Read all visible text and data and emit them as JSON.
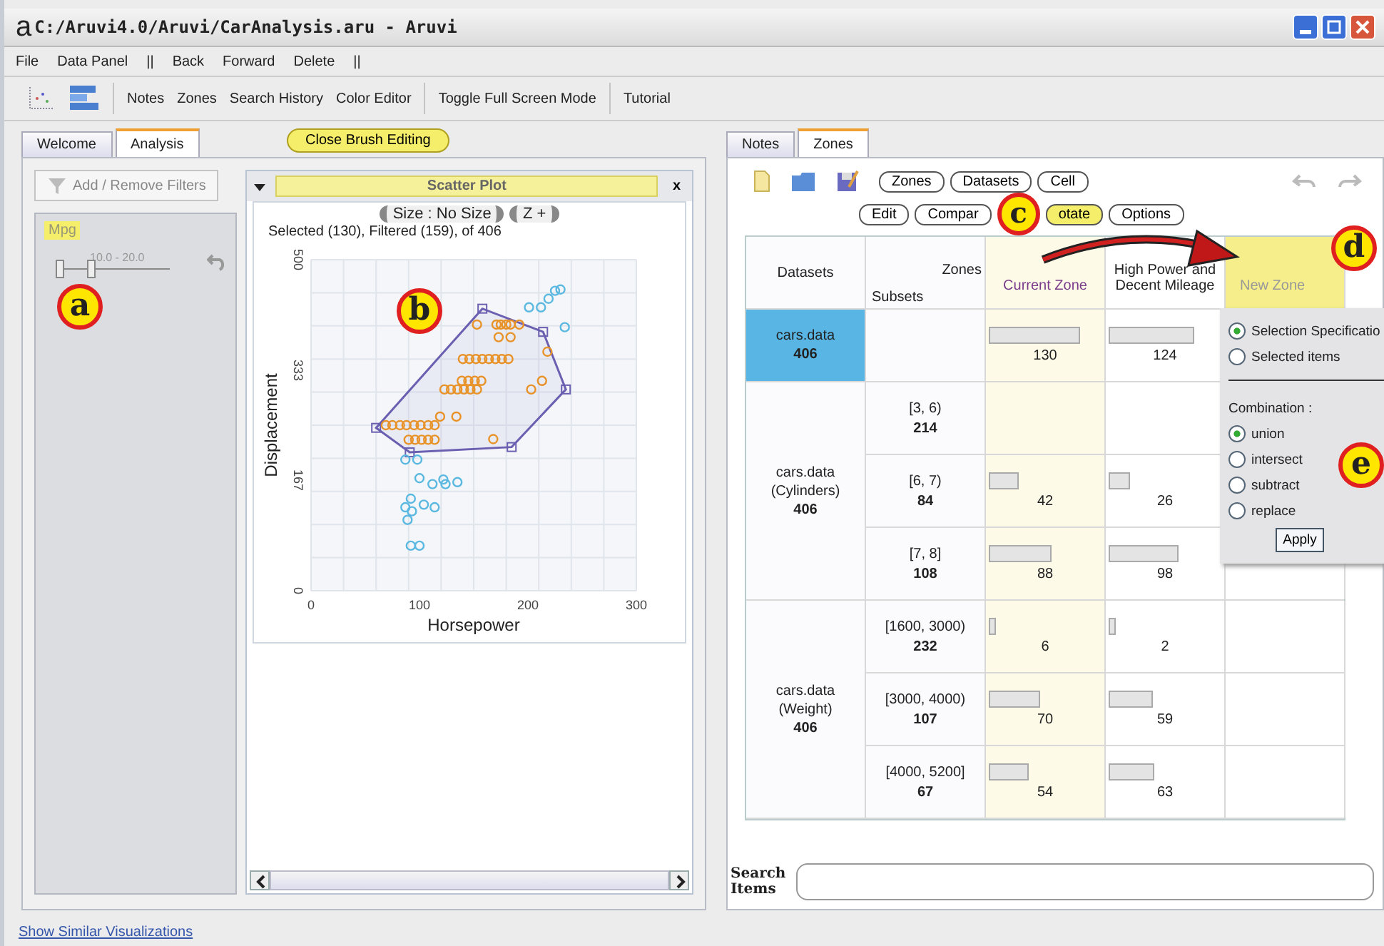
{
  "window": {
    "logo": "a",
    "title": "C:/Aruvi4.0/Aruvi/CarAnalysis.aru - Aruvi"
  },
  "menu": [
    "File",
    "Data Panel",
    "||",
    "Back",
    "Forward",
    "Delete",
    "||"
  ],
  "toolbar": [
    [
      "Notes",
      "Zones",
      "Search History",
      "Color Editor"
    ],
    [
      "Toggle Full Screen Mode"
    ],
    [
      "Tutorial"
    ]
  ],
  "left_tabs": [
    {
      "label": "Welcome",
      "selected": false
    },
    {
      "label": "Analysis",
      "selected": true
    }
  ],
  "brush_button": "Close Brush Editing",
  "filters": {
    "button": "Add / Remove Filters",
    "name": "Mpg",
    "range": "10.0 - 20.0",
    "level": 0.27
  },
  "scatter": {
    "title": "Scatter Plot",
    "close": "x",
    "size_control": "Size : No Size",
    "zoom_control": "Z +",
    "status": "Selected (130), Filtered (159),  of 406",
    "chart_data": {
      "type": "scatter",
      "xlabel": "Horsepower",
      "ylabel": "Displacement",
      "xlim": [
        0,
        300
      ],
      "ylim": [
        0,
        500
      ],
      "xticks": [
        0,
        100,
        200,
        300
      ],
      "yticks": [
        0,
        {
          "value": 167,
          "label": "167"
        },
        {
          "value": 333,
          "label": "333"
        },
        500
      ],
      "series": [
        {
          "color": "#e8932a",
          "x": [
            153,
            171,
            175,
            180,
            184,
            192,
            173,
            184,
            140,
            146,
            152,
            158,
            164,
            170,
            176,
            182,
            218,
            139,
            145,
            151,
            157,
            123,
            129,
            135,
            141,
            147,
            153,
            203,
            213,
            119,
            134,
            69,
            75,
            82,
            88,
            95,
            101,
            108,
            114,
            90,
            96,
            102,
            108,
            114,
            168
          ],
          "values": [
            402,
            402,
            402,
            402,
            402,
            402,
            383,
            383,
            350,
            350,
            350,
            350,
            350,
            350,
            350,
            350,
            361,
            317,
            317,
            317,
            317,
            304,
            304,
            304,
            304,
            304,
            304,
            304,
            317,
            263,
            263,
            250,
            250,
            250,
            250,
            250,
            250,
            250,
            250,
            228,
            228,
            228,
            228,
            228,
            229
          ]
        },
        {
          "color": "#5bb8e0",
          "x": [
            201,
            212,
            219,
            225,
            230,
            234,
            87,
            98,
            100,
            112,
            122,
            124,
            135,
            92,
            87,
            93,
            104,
            114,
            89,
            92,
            100
          ],
          "values": [
            428,
            428,
            441,
            453,
            455,
            398,
            198,
            198,
            170,
            161,
            168,
            161,
            164,
            139,
            126,
            120,
            130,
            126,
            107,
            68,
            68
          ]
        }
      ]
    }
  },
  "right_tabs": [
    {
      "label": "Notes",
      "selected": false
    },
    {
      "label": "Zones",
      "selected": true
    }
  ],
  "zone_buttons": [
    {
      "label": "Zones",
      "highlighted": false
    },
    {
      "label": "Datasets",
      "highlighted": false
    },
    {
      "label": "Cell",
      "highlighted": false
    }
  ],
  "zone_actions": [
    {
      "label": "Edit",
      "highlighted": false
    },
    {
      "label": "Compar",
      "highlighted": false
    },
    {
      "label": "otate",
      "highlighted": true
    },
    {
      "label": "Options",
      "highlighted": false
    }
  ],
  "table": {
    "datasets_header": "Datasets",
    "zones_header": "Zones",
    "subsets_header": "Subsets",
    "columns": [
      {
        "label": "Current Zone",
        "kind": "current"
      },
      {
        "label": "High Power and Decent Mileage",
        "kind": "normal"
      },
      {
        "label": "New Zone",
        "kind": "new"
      }
    ],
    "groups": [
      {
        "dataset": "cars.data",
        "count": "406",
        "selected": true,
        "subsets": [
          {
            "cells": [
              {
                "value": "130",
                "level": 0.8
              },
              {
                "value": "124",
                "level": 0.75
              }
            ]
          }
        ]
      },
      {
        "dataset": "cars.data",
        "attribute": "(Cylinders)",
        "count": "406",
        "selected": false,
        "subsets": [
          {
            "label": "[3, 6)",
            "count": "214"
          },
          {
            "label": "[6, 7)",
            "count": "84",
            "cells": [
              {
                "value": "42",
                "level": 0.27
              },
              {
                "value": "26",
                "level": 0.19
              }
            ]
          },
          {
            "label": "[7, 8]",
            "count": "108",
            "cells": [
              {
                "value": "88",
                "level": 0.56
              },
              {
                "value": "98",
                "level": 0.62
              }
            ]
          }
        ]
      },
      {
        "dataset": "cars.data",
        "attribute": "(Weight)",
        "count": "406",
        "selected": false,
        "subsets": [
          {
            "label": "[1600, 3000)",
            "count": "232",
            "cells": [
              {
                "value": "6",
                "level": 0.07
              },
              {
                "value": "2",
                "level": 0.07
              }
            ]
          },
          {
            "label": "[3000, 4000)",
            "count": "107",
            "cells": [
              {
                "value": "70",
                "level": 0.45
              },
              {
                "value": "59",
                "level": 0.39
              }
            ]
          },
          {
            "label": "[4000, 5200]",
            "count": "67",
            "cells": [
              {
                "value": "54",
                "level": 0.36
              },
              {
                "value": "63",
                "level": 0.4
              }
            ]
          }
        ]
      }
    ]
  },
  "popup": {
    "sources": [
      {
        "label": "Selection Specificatio",
        "selected": true
      },
      {
        "label": "Selected items",
        "selected": false
      }
    ],
    "combination_label": "Combination :",
    "combinations": [
      {
        "label": "union",
        "selected": true
      },
      {
        "label": "intersect",
        "selected": false
      },
      {
        "label": "subtract",
        "selected": false
      },
      {
        "label": "replace",
        "selected": false
      }
    ],
    "apply": "Apply"
  },
  "search": {
    "label": "Search Items"
  },
  "link": "Show Similar Visualizations",
  "annotations": [
    "a",
    "b",
    "c",
    "d",
    "e"
  ]
}
